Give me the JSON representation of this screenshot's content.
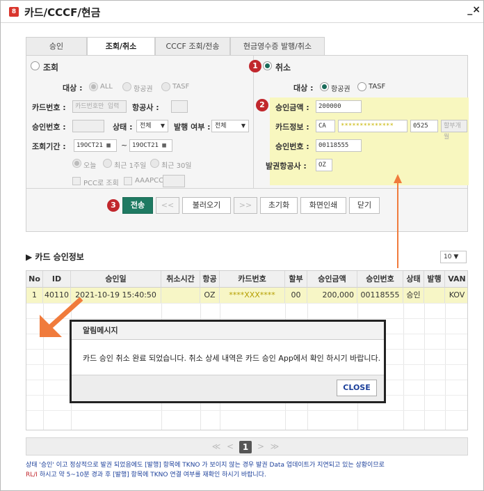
{
  "window": {
    "badge": "8",
    "title": "카드/CCCF/현금",
    "close_glyph": "_×"
  },
  "tabs": [
    "승인",
    "조회/취소",
    "CCCF 조회/전송",
    "현금영수증 발행/취소"
  ],
  "left": {
    "radio_label": "조회",
    "target_label": "대상 :",
    "target_options": [
      "ALL",
      "항공권",
      "TASF"
    ],
    "card_no_label": "카드번호 :",
    "card_no_placeholder": "카드번호만 입력",
    "airline_label": "항공사 :",
    "approval_no_label": "승인번호 :",
    "status_label": "상태 :",
    "status_value": "전체",
    "issue_label": "발행 여부 :",
    "issue_value": "전체",
    "period_label": "조회기간 :",
    "date_from": "19OCT21",
    "date_sep": "~",
    "date_to": "19OCT21",
    "range_options": [
      "오늘",
      "최근 1주일",
      "최근 30일"
    ],
    "pcc_label": "PCC로 조회",
    "aaapcc_label": "AAAPCC"
  },
  "right": {
    "radio_label": "취소",
    "target_label": "대상 :",
    "target_options": [
      "항공권",
      "TASF"
    ],
    "amount_label": "승인금액 :",
    "amount_value": "200000",
    "card_info_label": "카드정보 :",
    "card_type": "CA",
    "card_masked": "**************",
    "card_last": "0525",
    "installment_label": "할부개월",
    "approval_no_label": "승인번호 :",
    "approval_no_value": "00118555",
    "issuer_label": "발권항공사 :",
    "issuer_value": "OZ"
  },
  "markers": [
    "1",
    "2",
    "3"
  ],
  "buttons": {
    "send": "전송",
    "prev": "<<",
    "load": "불러오기",
    "next": ">>",
    "reset": "초기화",
    "print": "화면인쇄",
    "close": "닫기"
  },
  "section": {
    "title": "▶ 카드 승인정보",
    "page_size": "10 ▼"
  },
  "grid": {
    "headers": [
      "No",
      "ID",
      "승인일",
      "취소시간",
      "항공",
      "카드번호",
      "할부",
      "승인금액",
      "승인번호",
      "상태",
      "발행",
      "VAN"
    ],
    "rows": [
      [
        "1",
        "40110",
        "2021-10-19 15:40:50",
        "",
        "OZ",
        "****XXX****",
        "00",
        "200,000",
        "00118555",
        "승인",
        "",
        "KOV"
      ]
    ]
  },
  "pager": {
    "first": "≪",
    "prev": "<",
    "current": "1",
    "next": ">",
    "last": "≫"
  },
  "note": {
    "line1": "상태 '승인' 이고 정상적으로 발권 되었음에도 [발행] 항목에 TKNO 가 보이지 않는 경우 발권 Data 업데이트가 지연되고 있는 상황이므로",
    "line2_red": "RL/I",
    "line2": " 하시고 약 5~10분 경과 후 [발행] 항목에 TKNO 연결 여부를 재확인 하시기 바랍니다."
  },
  "dialog": {
    "title": "알림메시지",
    "message": "카드 승인 취소 완료 되었습니다. 취소 상세 내역은 카드 승인 App에서 확인 하시기 바랍니다.",
    "close": "CLOSE"
  },
  "colors": {
    "accent": "#1f7a62",
    "marker": "#c1272d",
    "highlight": "#f7f6c6",
    "arrow": "#f07b3c"
  }
}
